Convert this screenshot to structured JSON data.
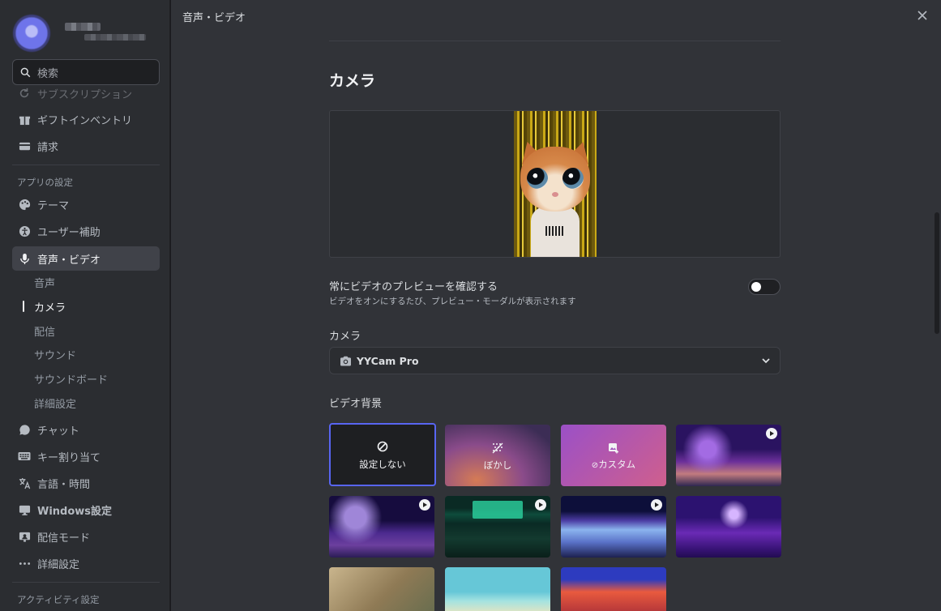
{
  "sidebar": {
    "search_placeholder": "検索",
    "top_items": [
      {
        "label": "サブスクリプション",
        "icon": "refresh-icon"
      },
      {
        "label": "ギフトインベントリ",
        "icon": "gift-icon"
      },
      {
        "label": "請求",
        "icon": "card-icon"
      }
    ],
    "app_settings_header": "アプリの設定",
    "app_items": [
      {
        "label": "テーマ",
        "icon": "palette-icon"
      },
      {
        "label": "ユーザー補助",
        "icon": "accessibility-icon"
      },
      {
        "label": "音声・ビデオ",
        "icon": "mic-icon"
      }
    ],
    "sub_items": [
      "音声",
      "カメラ",
      "配信",
      "サウンド",
      "サウンドボード",
      "詳細設定"
    ],
    "more_items": [
      {
        "label": "チャット",
        "icon": "chat-icon"
      },
      {
        "label": "キー割り当て",
        "icon": "keyboard-icon"
      },
      {
        "label": "言語・時間",
        "icon": "translate-icon"
      },
      {
        "label": "Windows設定",
        "icon": "monitor-icon"
      },
      {
        "label": "配信モード",
        "icon": "stream-icon"
      },
      {
        "label": "詳細設定",
        "icon": "dots-icon"
      }
    ],
    "activity_header": "アクティビティ設定"
  },
  "main": {
    "window_title": "音声・ビデオ",
    "heading": "カメラ",
    "always_preview": {
      "title": "常にビデオのプレビューを確認する",
      "description": "ビデオをオンにするたび、プレビュー・モーダルが表示されます",
      "enabled": false
    },
    "camera_label": "カメラ",
    "camera_selected": "YYCam Pro",
    "bg_label": "ビデオ背景",
    "bg_tiles": {
      "none": "設定しない",
      "blur": "ぼかし",
      "custom": "カスタム"
    }
  },
  "colors": {
    "accent": "#5865f2",
    "sidebar_bg": "#2b2d31",
    "main_bg": "#313338"
  }
}
